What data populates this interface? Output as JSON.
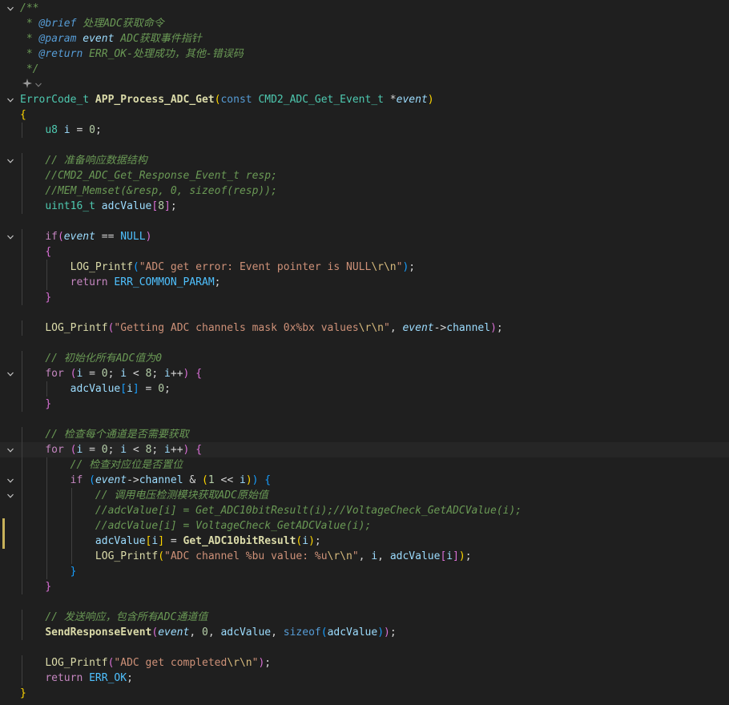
{
  "editor": {
    "lines": [
      {
        "fold": true,
        "tokens": [
          [
            "/**",
            "comment"
          ]
        ]
      },
      {
        "tokens": [
          [
            " * ",
            "comment"
          ],
          [
            "@brief",
            "tag"
          ],
          [
            " 处理ADC获取命令",
            "comment"
          ]
        ]
      },
      {
        "tokens": [
          [
            " * ",
            "comment"
          ],
          [
            "@param",
            "tag"
          ],
          [
            " ",
            "comment"
          ],
          [
            "event",
            "ident-it"
          ],
          [
            " ADC获取事件指针",
            "comment"
          ]
        ]
      },
      {
        "tokens": [
          [
            " * ",
            "comment"
          ],
          [
            "@return",
            "tag"
          ],
          [
            " ERR_OK-处理成功，其他-错误码",
            "comment"
          ]
        ]
      },
      {
        "tokens": [
          [
            " */",
            "comment"
          ]
        ]
      },
      {
        "tokens": []
      },
      {
        "fold": true,
        "tokens": [
          [
            "ErrorCode_t",
            "type"
          ],
          [
            " ",
            "plain"
          ],
          [
            "APP_Process_ADC_Get",
            "fn"
          ],
          [
            "(",
            "brace1"
          ],
          [
            "const",
            "kwb"
          ],
          [
            " ",
            "plain"
          ],
          [
            "CMD2_ADC_Get_Event_t",
            "type"
          ],
          [
            " *",
            "plain"
          ],
          [
            "event",
            "param"
          ],
          [
            ")",
            "brace1"
          ]
        ]
      },
      {
        "tokens": [
          [
            "{",
            "brace1"
          ]
        ]
      },
      {
        "tokens": [
          [
            "    ",
            "plain"
          ],
          [
            "u8",
            "type"
          ],
          [
            " ",
            "plain"
          ],
          [
            "i",
            "var"
          ],
          [
            " = ",
            "plain"
          ],
          [
            "0",
            "num"
          ],
          [
            ";",
            "punc"
          ]
        ]
      },
      {
        "tokens": []
      },
      {
        "fold": true,
        "tokens": [
          [
            "    ",
            "plain"
          ],
          [
            "// 准备响应数据结构",
            "comment"
          ]
        ]
      },
      {
        "tokens": [
          [
            "    ",
            "plain"
          ],
          [
            "//CMD2_ADC_Get_Response_Event_t resp;",
            "comment"
          ]
        ]
      },
      {
        "tokens": [
          [
            "    ",
            "plain"
          ],
          [
            "//MEM_Memset(&resp, 0, sizeof(resp));",
            "comment"
          ]
        ]
      },
      {
        "tokens": [
          [
            "    ",
            "plain"
          ],
          [
            "uint16_t",
            "type"
          ],
          [
            " ",
            "plain"
          ],
          [
            "adcValue",
            "var"
          ],
          [
            "[",
            "brace2"
          ],
          [
            "8",
            "num"
          ],
          [
            "]",
            "brace2"
          ],
          [
            ";",
            "punc"
          ]
        ]
      },
      {
        "tokens": []
      },
      {
        "fold": true,
        "tokens": [
          [
            "    ",
            "plain"
          ],
          [
            "if",
            "kw"
          ],
          [
            "(",
            "brace2"
          ],
          [
            "event",
            "param"
          ],
          [
            " == ",
            "plain"
          ],
          [
            "NULL",
            "const"
          ],
          [
            ")",
            "brace2"
          ]
        ]
      },
      {
        "tokens": [
          [
            "    ",
            "plain"
          ],
          [
            "{",
            "brace2"
          ]
        ]
      },
      {
        "tokens": [
          [
            "        ",
            "plain"
          ],
          [
            "LOG_Printf",
            "fnplain"
          ],
          [
            "(",
            "brace3"
          ],
          [
            "\"ADC get error: Event pointer is NULL",
            "str"
          ],
          [
            "\\r\\n",
            "esc"
          ],
          [
            "\"",
            "str"
          ],
          [
            ")",
            "brace3"
          ],
          [
            ";",
            "punc"
          ]
        ]
      },
      {
        "tokens": [
          [
            "        ",
            "plain"
          ],
          [
            "return",
            "kw"
          ],
          [
            " ",
            "plain"
          ],
          [
            "ERR_COMMON_PARAM",
            "const"
          ],
          [
            ";",
            "punc"
          ]
        ]
      },
      {
        "tokens": [
          [
            "    ",
            "plain"
          ],
          [
            "}",
            "brace2"
          ]
        ]
      },
      {
        "tokens": []
      },
      {
        "tokens": [
          [
            "    ",
            "plain"
          ],
          [
            "LOG_Printf",
            "fnplain"
          ],
          [
            "(",
            "brace2"
          ],
          [
            "\"Getting ADC channels mask 0x%bx values",
            "str"
          ],
          [
            "\\r\\n",
            "esc"
          ],
          [
            "\"",
            "str"
          ],
          [
            ", ",
            "plain"
          ],
          [
            "event",
            "param"
          ],
          [
            "->",
            "plain"
          ],
          [
            "channel",
            "var"
          ],
          [
            ")",
            "brace2"
          ],
          [
            ";",
            "punc"
          ]
        ]
      },
      {
        "tokens": []
      },
      {
        "tokens": [
          [
            "    ",
            "plain"
          ],
          [
            "// 初始化所有ADC值为0",
            "comment"
          ]
        ]
      },
      {
        "fold": true,
        "tokens": [
          [
            "    ",
            "plain"
          ],
          [
            "for",
            "kw"
          ],
          [
            " ",
            "plain"
          ],
          [
            "(",
            "brace2"
          ],
          [
            "i",
            "var"
          ],
          [
            " = ",
            "plain"
          ],
          [
            "0",
            "num"
          ],
          [
            "; ",
            "plain"
          ],
          [
            "i",
            "var"
          ],
          [
            " < ",
            "plain"
          ],
          [
            "8",
            "num"
          ],
          [
            "; ",
            "plain"
          ],
          [
            "i",
            "var"
          ],
          [
            "++",
            "plain"
          ],
          [
            ")",
            "brace2"
          ],
          [
            " ",
            "plain"
          ],
          [
            "{",
            "brace2"
          ]
        ]
      },
      {
        "tokens": [
          [
            "        ",
            "plain"
          ],
          [
            "adcValue",
            "var"
          ],
          [
            "[",
            "brace3"
          ],
          [
            "i",
            "var"
          ],
          [
            "]",
            "brace3"
          ],
          [
            " = ",
            "plain"
          ],
          [
            "0",
            "num"
          ],
          [
            ";",
            "punc"
          ]
        ]
      },
      {
        "tokens": [
          [
            "    ",
            "plain"
          ],
          [
            "}",
            "brace2"
          ]
        ]
      },
      {
        "tokens": []
      },
      {
        "tokens": [
          [
            "    ",
            "plain"
          ],
          [
            "// 检查每个通道是否需要获取",
            "comment"
          ]
        ]
      },
      {
        "fold": true,
        "current": true,
        "tokens": [
          [
            "    ",
            "plain"
          ],
          [
            "for",
            "kw"
          ],
          [
            " ",
            "plain"
          ],
          [
            "(",
            "brace2"
          ],
          [
            "i",
            "var"
          ],
          [
            " = ",
            "plain"
          ],
          [
            "0",
            "num"
          ],
          [
            "; ",
            "plain"
          ],
          [
            "i",
            "var"
          ],
          [
            " < ",
            "plain"
          ],
          [
            "8",
            "num"
          ],
          [
            "; ",
            "plain"
          ],
          [
            "i",
            "var"
          ],
          [
            "++",
            "plain"
          ],
          [
            ")",
            "brace2"
          ],
          [
            " ",
            "plain"
          ],
          [
            "{",
            "brace2"
          ]
        ]
      },
      {
        "tokens": [
          [
            "        ",
            "plain"
          ],
          [
            "// 检查对应位是否置位",
            "comment"
          ]
        ]
      },
      {
        "fold": true,
        "tokens": [
          [
            "        ",
            "plain"
          ],
          [
            "if",
            "kw"
          ],
          [
            " ",
            "plain"
          ],
          [
            "(",
            "brace3"
          ],
          [
            "event",
            "param"
          ],
          [
            "->",
            "plain"
          ],
          [
            "channel",
            "var"
          ],
          [
            " & ",
            "plain"
          ],
          [
            "(",
            "brace1"
          ],
          [
            "1",
            "num"
          ],
          [
            " << ",
            "plain"
          ],
          [
            "i",
            "var"
          ],
          [
            ")",
            "brace1"
          ],
          [
            ")",
            "brace3"
          ],
          [
            " ",
            "plain"
          ],
          [
            "{",
            "brace3"
          ]
        ]
      },
      {
        "fold": true,
        "tokens": [
          [
            "            ",
            "plain"
          ],
          [
            "// 调用电压检测模块获取ADC原始值",
            "comment"
          ]
        ]
      },
      {
        "tokens": [
          [
            "            ",
            "plain"
          ],
          [
            "//adcValue[i] = Get_ADC10bitResult(i);//VoltageCheck_GetADCValue(i);",
            "comment"
          ]
        ]
      },
      {
        "modified": true,
        "tokens": [
          [
            "            ",
            "plain"
          ],
          [
            "//adcValue[i] = VoltageCheck_GetADCValue(i);",
            "comment"
          ]
        ]
      },
      {
        "modified": true,
        "tokens": [
          [
            "            ",
            "plain"
          ],
          [
            "adcValue",
            "var"
          ],
          [
            "[",
            "brace1"
          ],
          [
            "i",
            "var"
          ],
          [
            "]",
            "brace1"
          ],
          [
            " = ",
            "plain"
          ],
          [
            "Get_ADC10bitResult",
            "fn"
          ],
          [
            "(",
            "brace1"
          ],
          [
            "i",
            "var"
          ],
          [
            ")",
            "brace1"
          ],
          [
            ";",
            "punc"
          ]
        ]
      },
      {
        "tokens": [
          [
            "            ",
            "plain"
          ],
          [
            "LOG_Printf",
            "fnplain"
          ],
          [
            "(",
            "brace1"
          ],
          [
            "\"ADC channel %bu value: %u",
            "str"
          ],
          [
            "\\r\\n",
            "esc"
          ],
          [
            "\"",
            "str"
          ],
          [
            ", ",
            "plain"
          ],
          [
            "i",
            "var"
          ],
          [
            ", ",
            "plain"
          ],
          [
            "adcValue",
            "var"
          ],
          [
            "[",
            "brace2"
          ],
          [
            "i",
            "var"
          ],
          [
            "]",
            "brace2"
          ],
          [
            ")",
            "brace1"
          ],
          [
            ";",
            "punc"
          ]
        ]
      },
      {
        "tokens": [
          [
            "        ",
            "plain"
          ],
          [
            "}",
            "brace3"
          ]
        ]
      },
      {
        "tokens": [
          [
            "    ",
            "plain"
          ],
          [
            "}",
            "brace2"
          ]
        ]
      },
      {
        "tokens": []
      },
      {
        "tokens": [
          [
            "    ",
            "plain"
          ],
          [
            "// 发送响应，包含所有ADC通道值",
            "comment"
          ]
        ]
      },
      {
        "tokens": [
          [
            "    ",
            "plain"
          ],
          [
            "SendResponseEvent",
            "fn"
          ],
          [
            "(",
            "brace2"
          ],
          [
            "event",
            "param"
          ],
          [
            ", ",
            "plain"
          ],
          [
            "0",
            "num"
          ],
          [
            ", ",
            "plain"
          ],
          [
            "adcValue",
            "var"
          ],
          [
            ", ",
            "plain"
          ],
          [
            "sizeof",
            "kwb"
          ],
          [
            "(",
            "brace3"
          ],
          [
            "adcValue",
            "var"
          ],
          [
            ")",
            "brace3"
          ],
          [
            ")",
            "brace2"
          ],
          [
            ";",
            "punc"
          ]
        ]
      },
      {
        "tokens": []
      },
      {
        "tokens": [
          [
            "    ",
            "plain"
          ],
          [
            "LOG_Printf",
            "fnplain"
          ],
          [
            "(",
            "brace2"
          ],
          [
            "\"ADC get completed",
            "str"
          ],
          [
            "\\r\\n",
            "esc"
          ],
          [
            "\"",
            "str"
          ],
          [
            ")",
            "brace2"
          ],
          [
            ";",
            "punc"
          ]
        ]
      },
      {
        "tokens": [
          [
            "    ",
            "plain"
          ],
          [
            "return",
            "kw"
          ],
          [
            " ",
            "plain"
          ],
          [
            "ERR_OK",
            "const"
          ],
          [
            ";",
            "punc"
          ]
        ]
      },
      {
        "tokens": [
          [
            "}",
            "brace1"
          ]
        ]
      }
    ]
  }
}
